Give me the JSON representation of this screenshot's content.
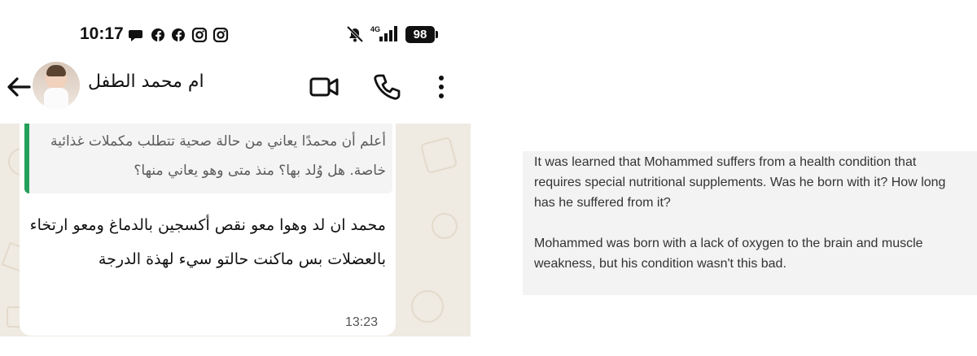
{
  "status_bar": {
    "time": "10:17",
    "network": "4G",
    "battery": "98"
  },
  "chat_header": {
    "contact_name": "ام محمد الطفل"
  },
  "message": {
    "quoted_text": "أعلم أن محمدًا يعاني من حالة صحية تتطلب مكملات غذائية خاصة. هل وُلد بها؟ منذ متى وهو يعاني منها؟",
    "text": "محمد ان لد وهوا معو نقص أكسجين بالدماغ ومعو ارتخاء بالعضلات بس ماكنت حالتو سيء لهذة الدرجة",
    "time": "13:23",
    "quote_bar_color": "#25a05a"
  },
  "translation": {
    "question": "It was learned that Mohammed suffers from a health condition that requires special nutritional supplements. Was he born with it? How long has he suffered from it?",
    "answer": "Mohammed was born with a lack of oxygen to the brain and muscle weakness, but his condition wasn't this bad."
  }
}
